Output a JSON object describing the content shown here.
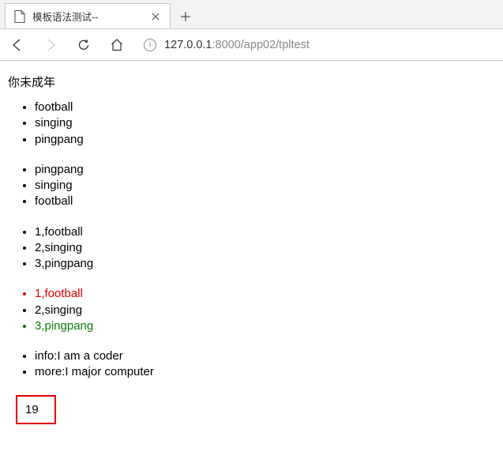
{
  "browser": {
    "tab_title": "模板语法测试--",
    "url_host": "127.0.0.1",
    "url_port": ":8000",
    "url_path": "/app02/tpltest"
  },
  "page": {
    "heading": "你未成年",
    "list1": [
      "football",
      "singing",
      "pingpang"
    ],
    "list2": [
      "pingpang",
      "singing",
      "football"
    ],
    "list3": [
      "1,football",
      "2,singing",
      "3,pingpang"
    ],
    "list4": [
      {
        "text": "1,football",
        "color": "red"
      },
      {
        "text": "2,singing",
        "color": ""
      },
      {
        "text": "3,pingpang",
        "color": "green"
      }
    ],
    "list5": [
      "info:I am a coder",
      "more:I major computer"
    ],
    "highlight_value": "19"
  }
}
